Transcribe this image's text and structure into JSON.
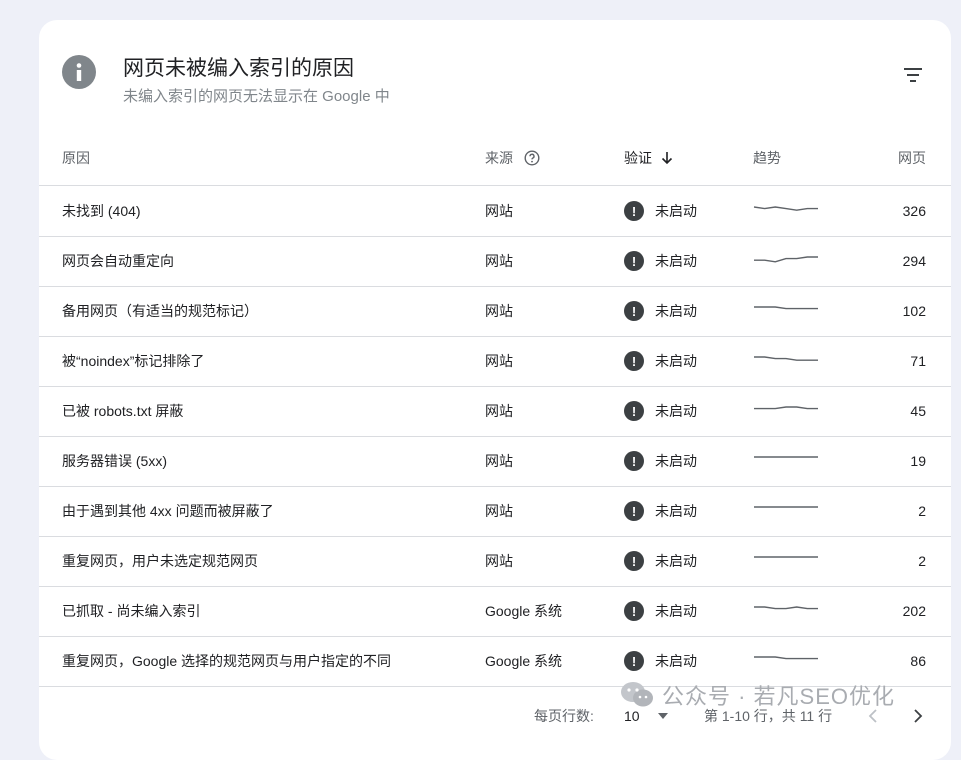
{
  "header": {
    "title": "网页未被编入索引的原因",
    "subtitle": "未编入索引的网页无法显示在 Google 中",
    "info_icon": "info-icon",
    "filter_icon": "filter-icon"
  },
  "columns": {
    "reason": "原因",
    "source": "来源",
    "validation": "验证",
    "trend": "趋势",
    "pages": "网页"
  },
  "rows": [
    {
      "reason": "未找到 (404)",
      "source": "网站",
      "validation": "未启动",
      "pages": "326",
      "trend": [
        5,
        4,
        5,
        4,
        3,
        4,
        4
      ]
    },
    {
      "reason": "网页会自动重定向",
      "source": "网站",
      "validation": "未启动",
      "pages": "294",
      "trend": [
        3,
        3,
        2,
        4,
        4,
        5,
        5
      ]
    },
    {
      "reason": "备用网页（有适当的规范标记）",
      "source": "网站",
      "validation": "未启动",
      "pages": "102",
      "trend": [
        5,
        5,
        5,
        4,
        4,
        4,
        4
      ]
    },
    {
      "reason": "被“noindex”标记排除了",
      "source": "网站",
      "validation": "未启动",
      "pages": "71",
      "trend": [
        5,
        5,
        4,
        4,
        3,
        3,
        3
      ]
    },
    {
      "reason": "已被 robots.txt 屏蔽",
      "source": "网站",
      "validation": "未启动",
      "pages": "45",
      "trend": [
        4,
        4,
        4,
        5,
        5,
        4,
        4
      ]
    },
    {
      "reason": "服务器错误 (5xx)",
      "source": "网站",
      "validation": "未启动",
      "pages": "19",
      "trend": [
        5,
        5,
        5,
        5,
        5,
        5,
        5
      ]
    },
    {
      "reason": "由于遇到其他 4xx 问题而被屏蔽了",
      "source": "网站",
      "validation": "未启动",
      "pages": "2",
      "trend": [
        5,
        5,
        5,
        5,
        5,
        5,
        5
      ]
    },
    {
      "reason": "重复网页，用户未选定规范网页",
      "source": "网站",
      "validation": "未启动",
      "pages": "2",
      "trend": [
        5,
        5,
        5,
        5,
        5,
        5,
        5
      ]
    },
    {
      "reason": "已抓取 - 尚未编入索引",
      "source": "Google 系统",
      "validation": "未启动",
      "pages": "202",
      "trend": [
        5,
        5,
        4,
        4,
        5,
        4,
        4
      ]
    },
    {
      "reason": "重复网页，Google 选择的规范网页与用户指定的不同",
      "source": "Google 系统",
      "validation": "未启动",
      "pages": "86",
      "trend": [
        5,
        5,
        5,
        4,
        4,
        4,
        4
      ]
    }
  ],
  "footer": {
    "rows_per_page_label": "每页行数:",
    "rows_per_page_value": "10",
    "range": "第 1-10 行，共 11 行"
  },
  "watermark": {
    "text": "公众号 · 若凡SEO优化"
  },
  "colors": {
    "background": "#eef0f8",
    "card": "#ffffff",
    "divider": "#dadce0",
    "status_icon": "#3c4043",
    "sparkline": "#5f6368"
  }
}
